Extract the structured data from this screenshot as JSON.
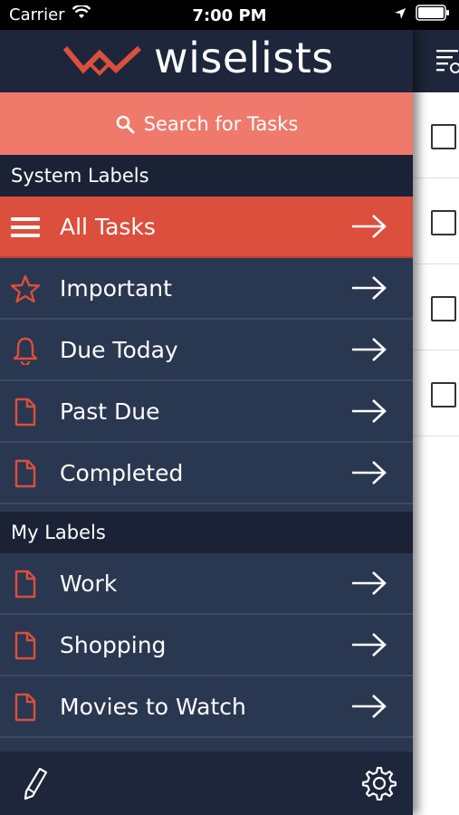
{
  "status_bar": {
    "carrier": "Carrier",
    "time": "7:00 PM"
  },
  "app": {
    "brand": "wiselists",
    "accent": "#db4f3c",
    "navy": "#2a3750",
    "search_bg": "#ef7a6c"
  },
  "search": {
    "placeholder": "Search for Tasks"
  },
  "system_labels": {
    "heading": "System Labels",
    "items": [
      {
        "label": "All Tasks",
        "icon": "hamburger-icon"
      },
      {
        "label": "Important",
        "icon": "star-icon"
      },
      {
        "label": "Due Today",
        "icon": "bell-icon"
      },
      {
        "label": "Past Due",
        "icon": "document-icon"
      },
      {
        "label": "Completed",
        "icon": "document-icon"
      }
    ]
  },
  "my_labels": {
    "heading": "My Labels",
    "items": [
      {
        "label": "Work",
        "icon": "document-icon"
      },
      {
        "label": "Shopping",
        "icon": "document-icon"
      },
      {
        "label": "Movies to Watch",
        "icon": "document-icon"
      }
    ]
  },
  "footer": {
    "left_icon": "pencil-icon",
    "right_icon": "gear-icon"
  }
}
